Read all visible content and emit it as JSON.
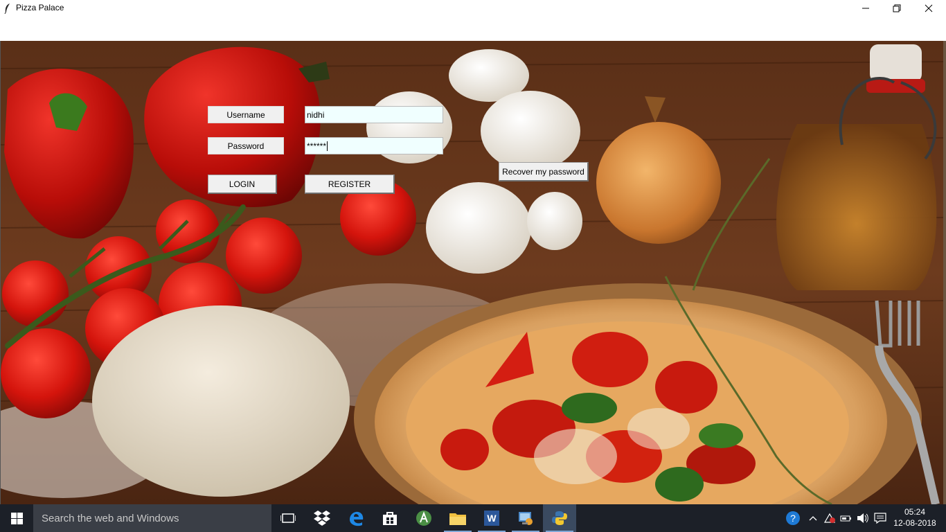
{
  "window": {
    "title": "Pizza Palace",
    "controls": [
      "minimize",
      "maximize",
      "close"
    ]
  },
  "login_form": {
    "username_label": "Username",
    "username_value": "nidhi",
    "password_label": "Password",
    "password_value": "******",
    "login_button": "LOGIN",
    "register_button": "REGISTER",
    "recover_button": "Recover my password"
  },
  "taskbar": {
    "search_placeholder": "Search the web and Windows",
    "pinned": [
      "task-view",
      "dropbox",
      "edge",
      "store",
      "android-studio",
      "file-explorer",
      "word",
      "control-panel",
      "python"
    ],
    "active_app": "python",
    "clock": {
      "time": "05:24",
      "date": "12-08-2018"
    }
  },
  "colors": {
    "entry_background": "#f0ffff",
    "widget_background": "#f0f0f0",
    "taskbar": "#1c2028"
  }
}
